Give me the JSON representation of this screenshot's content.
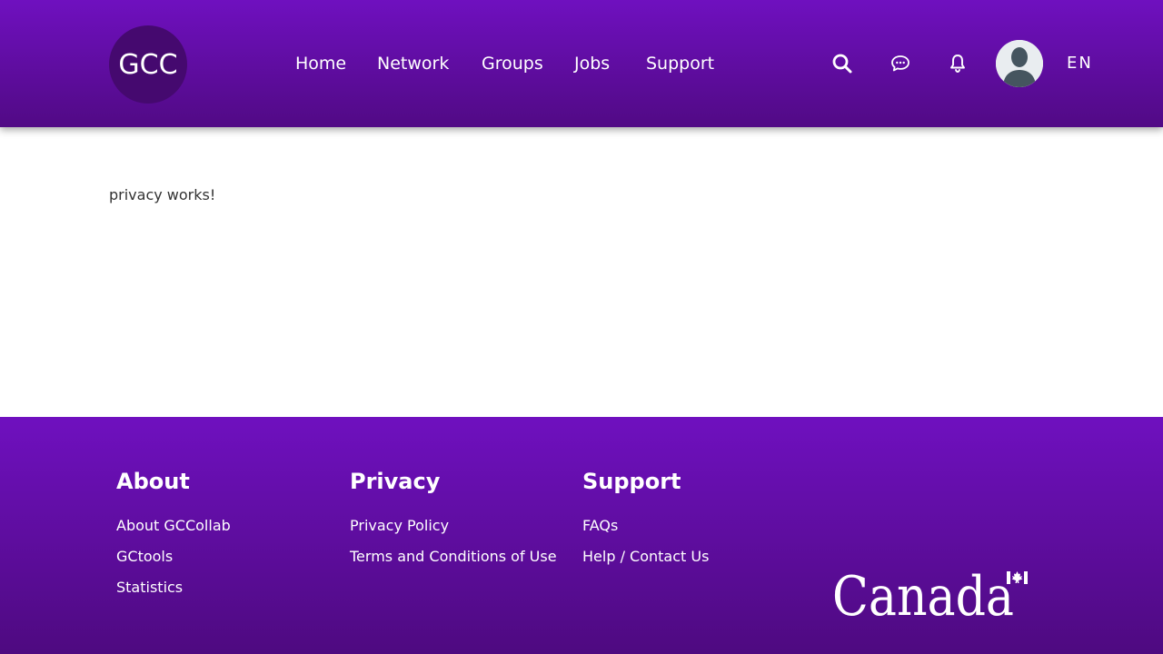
{
  "header": {
    "logo_text": "GCC",
    "nav": [
      {
        "label": "Home"
      },
      {
        "label": "Network"
      },
      {
        "label": "Groups"
      },
      {
        "label": "Jobs"
      },
      {
        "label": "Support"
      }
    ],
    "language": "EN",
    "icons": [
      "search-icon",
      "messages-icon",
      "notifications-bell-icon",
      "user-avatar"
    ]
  },
  "main": {
    "text": "privacy works!"
  },
  "footer": {
    "columns": [
      {
        "title": "About",
        "links": [
          "About GCCollab",
          "GCtools",
          "Statistics"
        ]
      },
      {
        "title": "Privacy",
        "links": [
          "Privacy Policy",
          "Terms and Conditions of Use"
        ]
      },
      {
        "title": "Support",
        "links": [
          "FAQs",
          "Help / Contact Us"
        ]
      }
    ],
    "wordmark": "Canada"
  },
  "colors": {
    "brand_purple": "#6f10bf",
    "brand_purple_dark": "#510a85",
    "logo_circle": "#45096f",
    "text": "#333333",
    "white": "#ffffff"
  }
}
